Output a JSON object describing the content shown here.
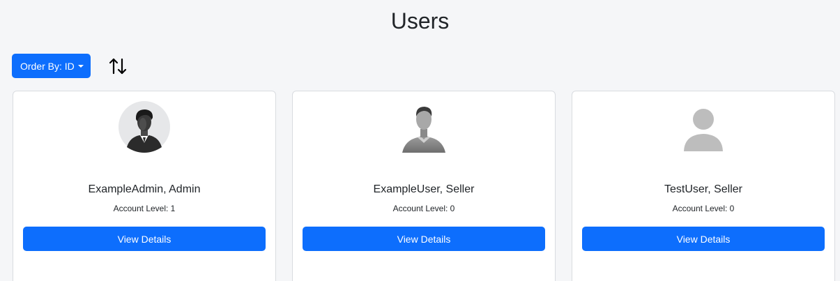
{
  "header": {
    "title": "Users"
  },
  "toolbar": {
    "order_by_label": "Order By: ID",
    "sort_icon": "sort-arrows-icon"
  },
  "users": [
    {
      "name_role": "ExampleAdmin, Admin",
      "account_level": "Account Level: 1",
      "button_label": "View Details",
      "avatar": "admin-avatar-icon"
    },
    {
      "name_role": "ExampleUser, Seller",
      "account_level": "Account Level: 0",
      "button_label": "View Details",
      "avatar": "user-avatar-icon"
    },
    {
      "name_role": "TestUser, Seller",
      "account_level": "Account Level: 0",
      "button_label": "View Details",
      "avatar": "default-avatar-icon"
    }
  ],
  "colors": {
    "primary": "#0d6efd",
    "background": "#f5f6f8",
    "card_border": "#d9dce0"
  }
}
